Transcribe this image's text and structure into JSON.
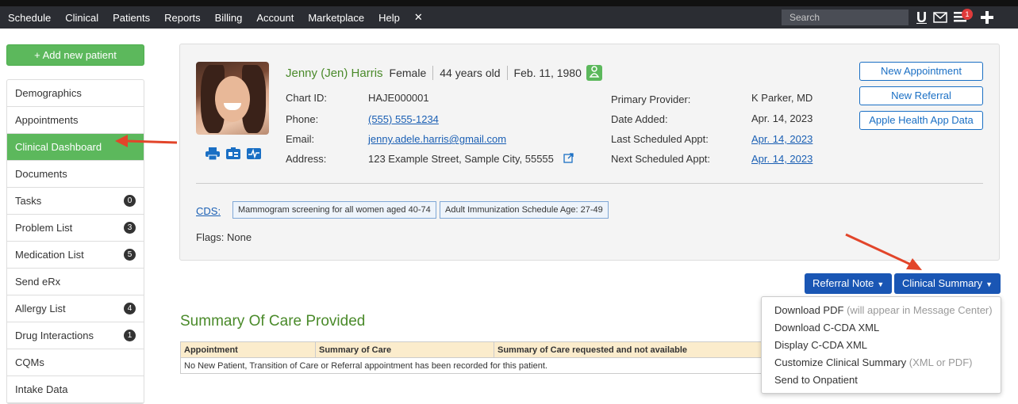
{
  "topnav": {
    "items": [
      "Schedule",
      "Clinical",
      "Patients",
      "Reports",
      "Billing",
      "Account",
      "Marketplace",
      "Help"
    ],
    "close_glyph": "✕",
    "search_placeholder": "Search",
    "notification_count": "1"
  },
  "sidebar": {
    "add_patient_label": "+ Add new patient",
    "items": [
      {
        "label": "Demographics",
        "count": ""
      },
      {
        "label": "Appointments",
        "count": ""
      },
      {
        "label": "Clinical Dashboard",
        "count": ""
      },
      {
        "label": "Documents",
        "count": ""
      },
      {
        "label": "Tasks",
        "count": "0"
      },
      {
        "label": "Problem List",
        "count": "3"
      },
      {
        "label": "Medication List",
        "count": "5"
      },
      {
        "label": "Send eRx",
        "count": ""
      },
      {
        "label": "Allergy List",
        "count": "4"
      },
      {
        "label": "Drug Interactions",
        "count": "1"
      },
      {
        "label": "CQMs",
        "count": ""
      },
      {
        "label": "Intake Data",
        "count": ""
      }
    ]
  },
  "patient": {
    "name": "Jenny (Jen) Harris",
    "gender": "Female",
    "age": "44 years old",
    "dob": "Feb. 11, 1980",
    "chart_id_label": "Chart ID:",
    "chart_id": "HAJE000001",
    "phone_label": "Phone:",
    "phone": "(555) 555-1234",
    "email_label": "Email:",
    "email": "jenny.adele.harris@gmail.com",
    "address_label": "Address:",
    "address": "123 Example Street, Sample City, 55555",
    "primary_provider_label": "Primary Provider:",
    "primary_provider": "K Parker, MD",
    "date_added_label": "Date Added:",
    "date_added": "Apr. 14, 2023",
    "last_appt_label": "Last Scheduled Appt:",
    "last_appt": "Apr. 14, 2023",
    "next_appt_label": "Next Scheduled Appt:",
    "next_appt": "Apr. 14, 2023"
  },
  "actions": {
    "new_appointment": "New Appointment",
    "new_referral": "New Referral",
    "apple_health": "Apple Health App Data"
  },
  "cds": {
    "label": "CDS:",
    "tags": [
      "Mammogram screening for all women aged 40-74",
      "Adult Immunization Schedule Age: 27-49"
    ]
  },
  "flags": {
    "label": "Flags:",
    "value": "None"
  },
  "buttons": {
    "referral_note": "Referral Note",
    "clinical_summary": "Clinical Summary"
  },
  "summary_of_care": {
    "title": "Summary Of Care Provided",
    "columns": [
      "Appointment",
      "Summary of Care",
      "Summary of Care requested and not available"
    ],
    "empty_message": "No New Patient, Transition of Care or Referral appointment has been recorded for this patient."
  },
  "clinical_summary_menu": {
    "download_pdf": "Download PDF",
    "download_pdf_note": "(will appear in Message Center)",
    "download_ccda": "Download C-CDA XML",
    "display_ccda": "Display C-CDA XML",
    "customize": "Customize Clinical Summary",
    "customize_note": "(XML or PDF)",
    "send_onpatient": "Send to Onpatient"
  },
  "colors": {
    "accent_green": "#5cb85c",
    "link_blue": "#1a5fb4",
    "button_blue": "#1a56b4",
    "annotation_red": "#e2452a"
  }
}
